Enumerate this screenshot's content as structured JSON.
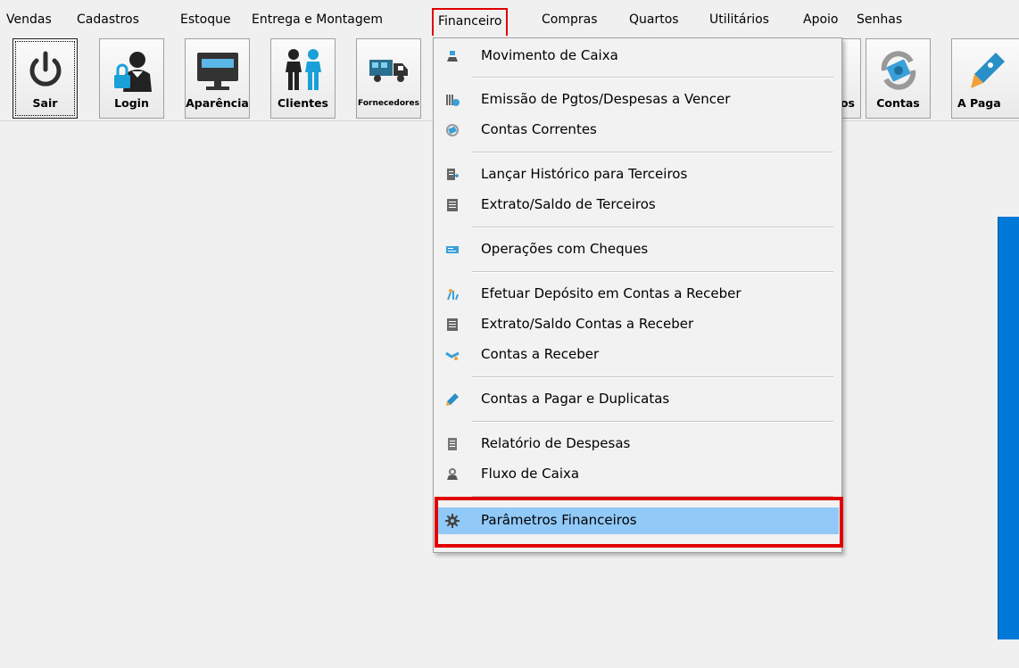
{
  "menubar": {
    "items": [
      "Vendas",
      "Cadastros",
      "Estoque",
      "Entrega e Montagem",
      "Financeiro",
      "Compras",
      "Quartos",
      "Utilitários",
      "Apoio",
      "Senhas"
    ],
    "active_index": 4
  },
  "toolbar": {
    "buttons": [
      {
        "label": "Sair",
        "icon": "power-icon"
      },
      {
        "label": "Login",
        "icon": "login-lock-icon"
      },
      {
        "label": "Aparência",
        "icon": "monitor-icon"
      },
      {
        "label": "Clientes",
        "icon": "clients-icon"
      },
      {
        "label": "Fornecedores",
        "icon": "truck-icon"
      },
      {
        "label": "rios",
        "icon": "document-icon"
      },
      {
        "label": "Contas",
        "icon": "money-cycle-icon"
      },
      {
        "label": "A Paga",
        "icon": "pen-icon"
      }
    ]
  },
  "financeiro_menu": {
    "items": [
      {
        "label": "Movimento de Caixa",
        "icon": "cash-register-icon"
      },
      {
        "label": "Emissão de Pgtos/Despesas a Vencer",
        "icon": "payment-bars-icon"
      },
      {
        "label": "Contas Correntes",
        "icon": "money-cycle-icon"
      },
      {
        "label": "Lançar Histórico para Terceiros",
        "icon": "document-add-icon"
      },
      {
        "label": "Extrato/Saldo de Terceiros",
        "icon": "statement-icon"
      },
      {
        "label": "Operações com Cheques",
        "icon": "check-icon"
      },
      {
        "label": "Efetuar Depósito em Contas a Receber",
        "icon": "deposit-icon"
      },
      {
        "label": "Extrato/Saldo Contas a Receber",
        "icon": "statement-icon"
      },
      {
        "label": "Contas a Receber",
        "icon": "receive-handshake-icon"
      },
      {
        "label": "Contas a Pagar e Duplicatas",
        "icon": "pen-icon"
      },
      {
        "label": "Relatório de Despesas",
        "icon": "report-icon"
      },
      {
        "label": "Fluxo de Caixa",
        "icon": "cash-flow-icon"
      },
      {
        "label": "Parâmetros Financeiros",
        "icon": "gear-icon"
      }
    ],
    "highlighted_index": 12
  },
  "colors": {
    "highlight": "#91c9f7",
    "annotation_red": "#e00000",
    "side_panel_blue": "#0078d7"
  }
}
